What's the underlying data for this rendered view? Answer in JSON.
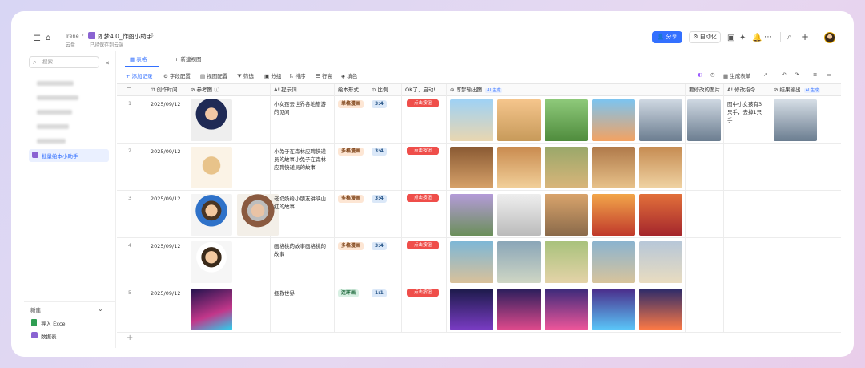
{
  "app": {
    "breadcrumb_user": "Irene",
    "doc_title": "即梦4.0_作图小助手",
    "location": "云盘",
    "save_status": "已经保存到云端",
    "share_label": "分享",
    "automation_label": "自动化"
  },
  "sidebar": {
    "search_placeholder": "搜索",
    "active_item": "批量绘本小助手",
    "new_label": "新建",
    "import_excel": "导入 Excel",
    "data_table": "数据表"
  },
  "tabs": {
    "table_tab": "表格",
    "new_view": "新建视图"
  },
  "toolbar": {
    "add_record": "添加记录",
    "field_config": "字段配置",
    "view_config": "视图配置",
    "filter": "筛选",
    "group": "分组",
    "sort": "排序",
    "row_height": "行高",
    "fill_color": "填色",
    "generate_form": "生成表单"
  },
  "columns": {
    "created": "创作时间",
    "ref": "参考图",
    "prompt": "提示词",
    "form": "绘本形式",
    "ratio": "比例",
    "ok": "OK了，启动!",
    "output": "即梦输出图",
    "output_ai": "AI 生成",
    "modify_img": "要修改的图片",
    "modify_cmd": "修改指令",
    "result": "结果输出",
    "result_ai": "AI 生成"
  },
  "rows": [
    {
      "num": "1",
      "date": "2025/09/12",
      "prompt": "小女孩去世界各地旅游的见闻",
      "form": "单格漫画",
      "ratio": "3:4",
      "button": "点击按钮",
      "cmd": "图中小女孩有3只手，去掉1只手"
    },
    {
      "num": "2",
      "date": "2025/09/12",
      "prompt": "小兔子在森林应聘快递员的故事小兔子在森林应聘快递员的故事",
      "form": "多格漫画",
      "ratio": "3:4",
      "button": "点击按钮",
      "cmd": ""
    },
    {
      "num": "3",
      "date": "2025/09/12",
      "prompt": "老奶奶给小朋友讲映山红的故事",
      "form": "多格漫画",
      "ratio": "3:4",
      "button": "点击按钮",
      "cmd": ""
    },
    {
      "num": "4",
      "date": "2025/09/12",
      "prompt": "画格桃的故事画格桃的故事",
      "form": "多格漫画",
      "ratio": "3:4",
      "button": "点击按钮",
      "cmd": ""
    },
    {
      "num": "5",
      "date": "2025/09/12",
      "prompt": "拯救世界",
      "form": "连环画",
      "ratio": "1:1",
      "button": "点击按钮",
      "cmd": ""
    }
  ],
  "colors": {
    "accent": "#3370ff",
    "red_button": "#ef4e4a"
  }
}
